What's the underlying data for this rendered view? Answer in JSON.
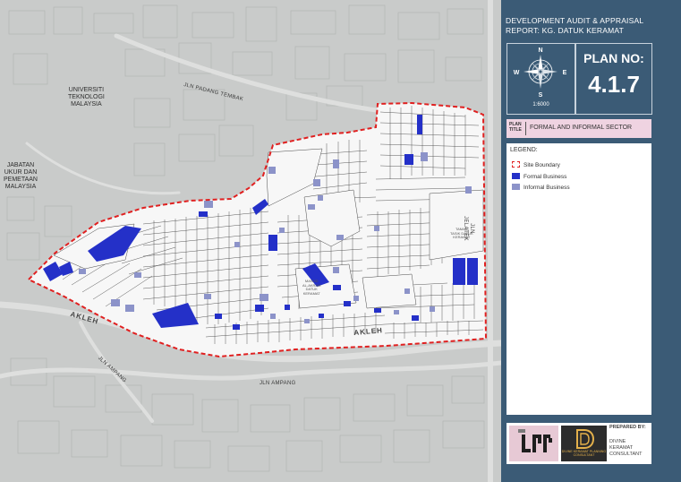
{
  "map": {
    "labels": {
      "uni": [
        "UNIVERSITI",
        "TEKNOLOGI",
        "MALAYSIA"
      ],
      "jabatan": [
        "JABATAN",
        "UKUR DAN",
        "PEMETAAN",
        "MALAYSIA"
      ],
      "jln_padang_tembak": "JLN PADANG TEMBAK",
      "jln_jelatek": "JLN JELATEK",
      "akleh_left": "AKLEH",
      "akleh_right": "AKLEH",
      "jln_ampang_left": "JLN AMPANG",
      "jln_ampang_bottom": "JLN AMPANG",
      "masjid": [
        "MASJID",
        "AL-AKRAM",
        "DATUK",
        "KERAMAT"
      ],
      "taman": [
        "TAMAN",
        "TASIK DATUK",
        "KERAMAT"
      ]
    },
    "colors": {
      "boundary": "#e02020",
      "formal": "#2430c8",
      "informal": "#8c93c9",
      "site_fill": "#f7f7f7",
      "background": "#c9cbca"
    }
  },
  "panel": {
    "title_line1": "DEVELOPMENT AUDIT & APPRAISAL",
    "title_line2": "REPORT: KG. DATUK KERAMAT",
    "scale": "1:6000",
    "compass": {
      "n": "N",
      "s": "S",
      "e": "E",
      "w": "W"
    },
    "plan_no_label": "PLAN NO:",
    "plan_no": "4.1.7",
    "plan_title_label_1": "PLAN",
    "plan_title_label_2": "TITLE",
    "plan_title": "FORMAL AND INFORMAL SECTOR",
    "legend": {
      "title": "LEGEND:",
      "items": [
        {
          "label": "Site Boundary",
          "swatch": "boundary"
        },
        {
          "label": "Formal Business",
          "swatch": "formal"
        },
        {
          "label": "Informal Business",
          "swatch": "informal"
        }
      ]
    },
    "footer": {
      "logo_text": "DIVINE KERAMAT PLANNING CONSULTANT",
      "prepared_by": "PREPARED BY:",
      "consultant": [
        "DIVINE",
        "KERAMAT",
        "CONSULTANT"
      ]
    },
    "colors": {
      "panel_bg": "#3b5b76",
      "title_band": "#efd3e1"
    }
  }
}
